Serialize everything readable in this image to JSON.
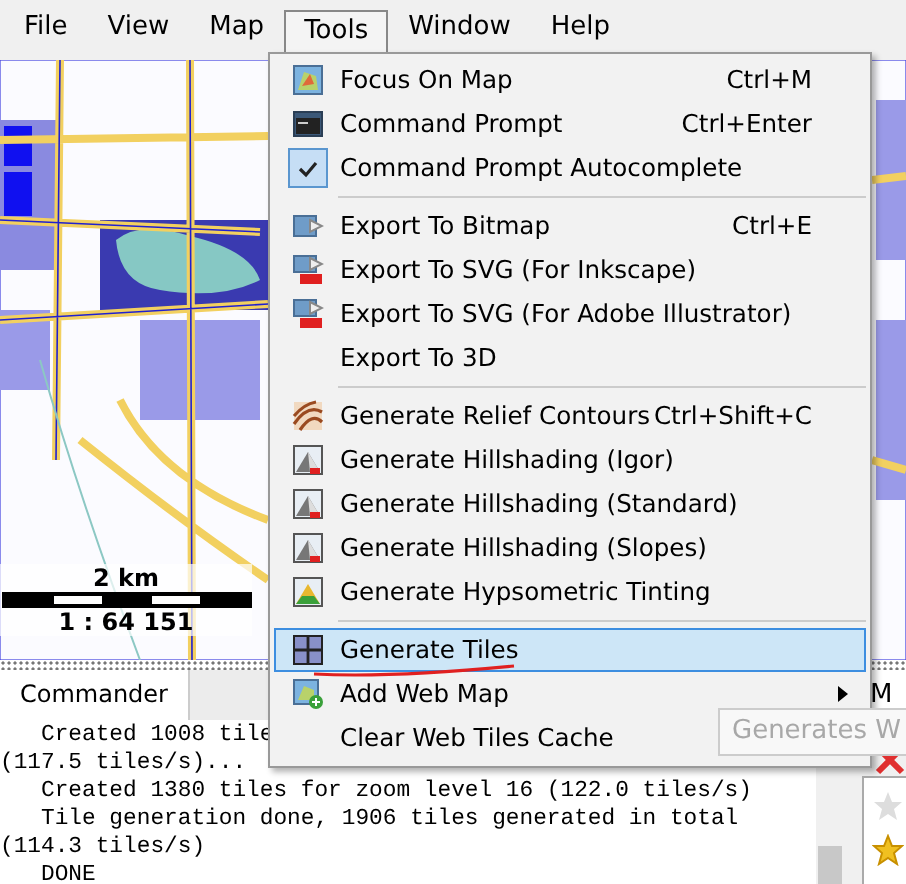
{
  "menubar": [
    {
      "label": "File",
      "selected": false
    },
    {
      "label": "View",
      "selected": false
    },
    {
      "label": "Map",
      "selected": false
    },
    {
      "label": "Tools",
      "selected": true
    },
    {
      "label": "Window",
      "selected": false
    },
    {
      "label": "Help",
      "selected": false
    }
  ],
  "map": {
    "kind": "picture",
    "scale_label": "2 km",
    "scale_ratio": "1 : 64 151"
  },
  "menu": {
    "items": [
      {
        "kind": "item",
        "label": "Focus On Map",
        "shortcut": "Ctrl+M",
        "checked": false,
        "selected": false,
        "submenu": false
      },
      {
        "kind": "item",
        "label": "Command Prompt",
        "shortcut": "Ctrl+Enter",
        "checked": false,
        "selected": false,
        "submenu": false
      },
      {
        "kind": "item",
        "label": "Command Prompt Autocomplete",
        "checked": true,
        "selected": false,
        "submenu": false
      },
      {
        "kind": "separator"
      },
      {
        "kind": "item",
        "label": "Export To Bitmap",
        "shortcut": "Ctrl+E",
        "checked": false,
        "selected": false,
        "submenu": false
      },
      {
        "kind": "item",
        "label": "Export To SVG (For Inkscape)",
        "checked": false,
        "selected": false,
        "submenu": false
      },
      {
        "kind": "item",
        "label": "Export To SVG (For Adobe Illustrator)",
        "checked": false,
        "selected": false,
        "submenu": false
      },
      {
        "kind": "item",
        "label": "Export To 3D",
        "checked": false,
        "selected": false,
        "submenu": false
      },
      {
        "kind": "separator"
      },
      {
        "kind": "item",
        "label": "Generate Relief Contours",
        "shortcut": "Ctrl+Shift+C",
        "checked": false,
        "selected": false,
        "submenu": false
      },
      {
        "kind": "item",
        "label": "Generate Hillshading (Igor)",
        "checked": false,
        "selected": false,
        "submenu": false
      },
      {
        "kind": "item",
        "label": "Generate Hillshading (Standard)",
        "checked": false,
        "selected": false,
        "submenu": false
      },
      {
        "kind": "item",
        "label": "Generate Hillshading (Slopes)",
        "checked": false,
        "selected": false,
        "submenu": false
      },
      {
        "kind": "item",
        "label": "Generate Hypsometric Tinting",
        "checked": false,
        "selected": false,
        "submenu": false
      },
      {
        "kind": "separator"
      },
      {
        "kind": "item",
        "label": "Generate Tiles",
        "checked": false,
        "selected": true,
        "submenu": false
      },
      {
        "kind": "item",
        "label": "Add Web Map",
        "checked": false,
        "selected": false,
        "submenu": true
      },
      {
        "kind": "item",
        "label": "Clear Web Tiles Cache",
        "checked": false,
        "selected": false,
        "submenu": false
      }
    ]
  },
  "tooltip": "Generates W",
  "panel_tabs": [
    {
      "label": "Commander",
      "selected": true
    }
  ],
  "console": {
    "lines": [
      "   Created 1008 tile",
      "(117.5 tiles/s)...",
      "   Created 1380 tiles for zoom level 16 (122.0 tiles/s)",
      "   Tile generation done, 1906 tiles generated in total",
      "(114.3 tiles/s)",
      "   DONE"
    ]
  },
  "side_panel": {
    "tab": "M"
  }
}
